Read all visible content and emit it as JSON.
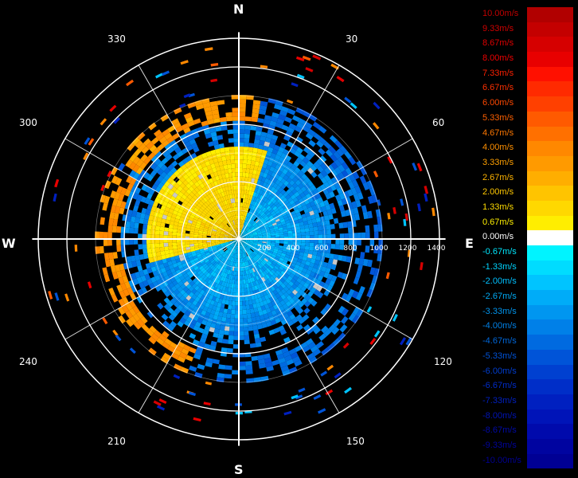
{
  "compass": {
    "north": "N",
    "south": "S",
    "east": "E",
    "west": "W"
  },
  "bearing_labels": [
    "30",
    "60",
    "120",
    "150",
    "210",
    "240",
    "300",
    "330"
  ],
  "chart_data": {
    "type": "heatmap",
    "subtype": "polar-ppi-radar-velocity",
    "range_axis": {
      "ticks": [
        200,
        400,
        600,
        800,
        1000,
        1200,
        1400
      ],
      "max": 1400
    },
    "range_rings": [
      400,
      800,
      1200
    ],
    "spokes_every_deg": 30,
    "approaching_sector": "NW quadrant (warm colors, positive)",
    "receding_sector": "S and E half (cool colors, negative)",
    "colorbar": [
      {
        "label": "10.00m/s",
        "value": 10.0,
        "color": "#b10000",
        "text_color": "#c00000"
      },
      {
        "label": "9.33m/s",
        "value": 9.33,
        "color": "#c40000",
        "text_color": "#d00000"
      },
      {
        "label": "8.67m/s",
        "value": 8.67,
        "color": "#d60000",
        "text_color": "#e00000"
      },
      {
        "label": "8.00m/s",
        "value": 8.0,
        "color": "#e80000",
        "text_color": "#f00000"
      },
      {
        "label": "7.33m/s",
        "value": 7.33,
        "color": "#ff1000",
        "text_color": "#ff2000"
      },
      {
        "label": "6.67m/s",
        "value": 6.67,
        "color": "#ff2a00",
        "text_color": "#ff3000"
      },
      {
        "label": "6.00m/s",
        "value": 6.0,
        "color": "#ff4000",
        "text_color": "#ff4800"
      },
      {
        "label": "5.33m/s",
        "value": 5.33,
        "color": "#ff5a00",
        "text_color": "#ff6000"
      },
      {
        "label": "4.67m/s",
        "value": 4.67,
        "color": "#ff7000",
        "text_color": "#ff7800"
      },
      {
        "label": "4.00m/s",
        "value": 4.0,
        "color": "#ff8800",
        "text_color": "#ff9000"
      },
      {
        "label": "3.33m/s",
        "value": 3.33,
        "color": "#ff9a00",
        "text_color": "#ffa000"
      },
      {
        "label": "2.67m/s",
        "value": 2.67,
        "color": "#ffae00",
        "text_color": "#ffb400"
      },
      {
        "label": "2.00m/s",
        "value": 2.0,
        "color": "#ffc400",
        "text_color": "#ffc800"
      },
      {
        "label": "1.33m/s",
        "value": 1.33,
        "color": "#ffd800",
        "text_color": "#ffdc00"
      },
      {
        "label": "0.67m/s",
        "value": 0.67,
        "color": "#ffee00",
        "text_color": "#fff000"
      },
      {
        "label": "0.00m/s",
        "value": 0.0,
        "color": "#ffffff",
        "text_color": "#ffffff"
      },
      {
        "label": "-0.67m/s",
        "value": -0.67,
        "color": "#00f4ff",
        "text_color": "#00e8ff"
      },
      {
        "label": "-1.33m/s",
        "value": -1.33,
        "color": "#00dcff",
        "text_color": "#00d4ff"
      },
      {
        "label": "-2.00m/s",
        "value": -2.0,
        "color": "#00c4ff",
        "text_color": "#00c0ff"
      },
      {
        "label": "-2.67m/s",
        "value": -2.67,
        "color": "#00acf8",
        "text_color": "#00aaf4"
      },
      {
        "label": "-3.33m/s",
        "value": -3.33,
        "color": "#0096f0",
        "text_color": "#0094ec"
      },
      {
        "label": "-4.00m/s",
        "value": -4.0,
        "color": "#0080e8",
        "text_color": "#0080e6"
      },
      {
        "label": "-4.67m/s",
        "value": -4.67,
        "color": "#006ae0",
        "text_color": "#0068dc"
      },
      {
        "label": "-5.33m/s",
        "value": -5.33,
        "color": "#0054d8",
        "text_color": "#0052d6"
      },
      {
        "label": "-6.00m/s",
        "value": -6.0,
        "color": "#0040d0",
        "text_color": "#003ed0"
      },
      {
        "label": "-6.67m/s",
        "value": -6.67,
        "color": "#002ec8",
        "text_color": "#002cc8"
      },
      {
        "label": "-7.33m/s",
        "value": -7.33,
        "color": "#0020c0",
        "text_color": "#0020c0"
      },
      {
        "label": "-8.00m/s",
        "value": -8.0,
        "color": "#0014b8",
        "text_color": "#0014b4"
      },
      {
        "label": "-8.67m/s",
        "value": -8.67,
        "color": "#000aac",
        "text_color": "#000aa8"
      },
      {
        "label": "-9.33m/s",
        "value": -9.33,
        "color": "#0004a0",
        "text_color": "#00049c"
      },
      {
        "label": "-10.00m/s",
        "value": -10.0,
        "color": "#000094",
        "text_color": "#000090"
      }
    ]
  }
}
